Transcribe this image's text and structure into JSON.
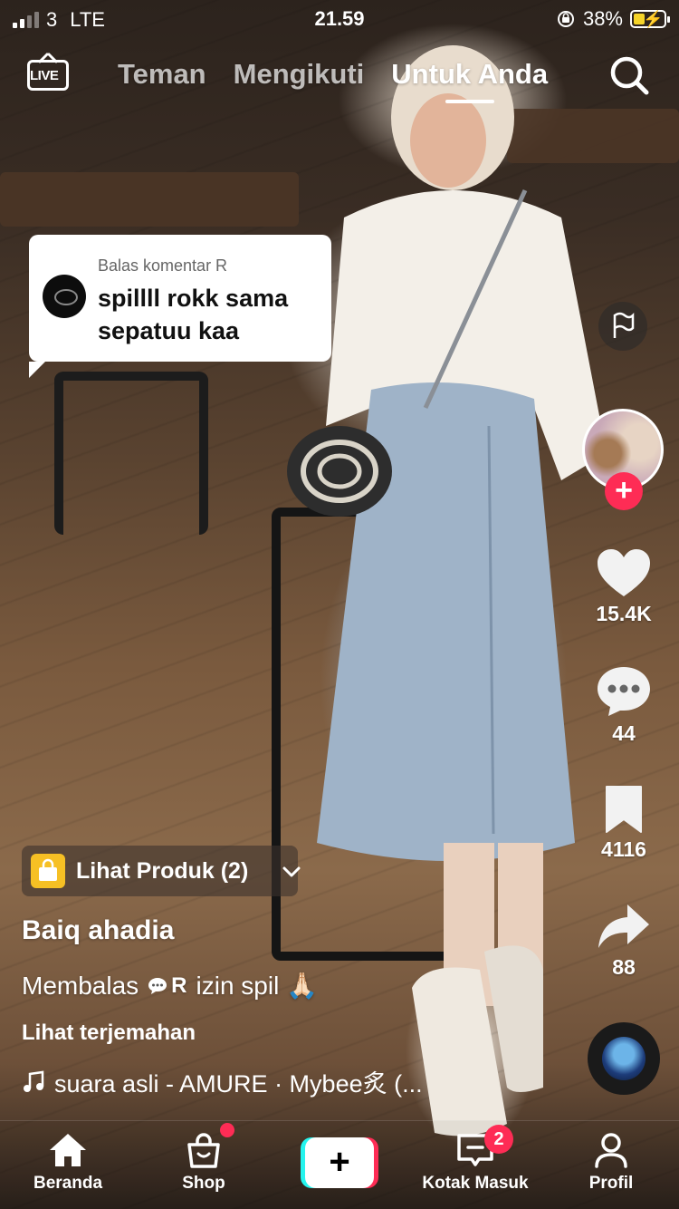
{
  "status_bar": {
    "carrier": "3",
    "network": "LTE",
    "time": "21.59",
    "battery": "38%"
  },
  "top_nav": {
    "live_label": "LIVE",
    "tabs": [
      {
        "label": "Teman",
        "active": false
      },
      {
        "label": "Mengikuti",
        "active": false
      },
      {
        "label": "Untuk Anda",
        "active": true
      }
    ]
  },
  "reply_sticker": {
    "header": "Balas komentar R",
    "comment": "spillll rokk sama sepatuu kaa"
  },
  "actions": {
    "likes": "15.4K",
    "comments": "44",
    "saves": "4116",
    "shares": "88"
  },
  "product": {
    "label": "Lihat Produk (2)"
  },
  "post": {
    "author": "Baiq ahadia",
    "caption_prefix": "Membalas",
    "reply_to": "R",
    "caption_text": "izin spil 🙏🏻",
    "translate_label": "Lihat terjemahan",
    "music": "suara asli - AMURE · Mybee炙 (..."
  },
  "bottom_nav": {
    "home": "Beranda",
    "shop": "Shop",
    "inbox": "Kotak Masuk",
    "inbox_badge": "2",
    "profile": "Profil"
  },
  "colors": {
    "accent": "#fe2c55",
    "cyan": "#25f4ee",
    "shop_bag": "#f6c024"
  },
  "icons": [
    "live-icon",
    "search-icon",
    "flag-icon",
    "heart-icon",
    "comment-icon",
    "bookmark-icon",
    "share-icon",
    "music-note-icon",
    "home-icon",
    "shop-icon",
    "plus-icon",
    "inbox-icon",
    "profile-icon",
    "chevron-down-icon"
  ]
}
